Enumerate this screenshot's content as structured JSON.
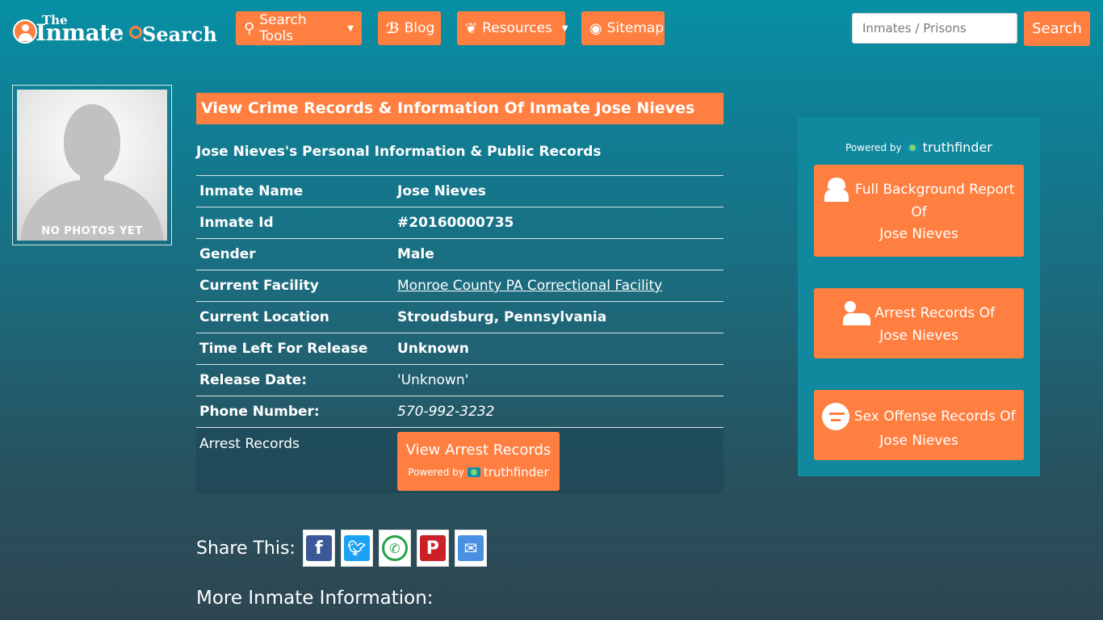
{
  "header": {
    "logo": {
      "the": "The",
      "inmate": "Inmate",
      "search": "Search"
    },
    "nav": [
      {
        "label": "Search Tools",
        "icon": "search-icon",
        "dropdown": true
      },
      {
        "label": "Blog",
        "icon": "blog-icon",
        "dropdown": false
      },
      {
        "label": "Resources",
        "icon": "leaf-icon",
        "dropdown": true
      },
      {
        "label": "Sitemap",
        "icon": "rss-icon",
        "dropdown": false
      }
    ],
    "search": {
      "placeholder": "Inmates / Prisons",
      "button": "Search"
    }
  },
  "photo": {
    "label": "NO PHOTOS YET"
  },
  "main": {
    "title": "View Crime Records & Information Of Inmate Jose Nieves",
    "subtitle": "Jose Nieves's Personal Information & Public Records",
    "rows": [
      {
        "key": "Inmate Name",
        "value": "Jose Nieves"
      },
      {
        "key": "Inmate Id",
        "value": "#20160000735"
      },
      {
        "key": "Gender",
        "value": "Male"
      },
      {
        "key": "Current Facility",
        "value": "Monroe County PA Correctional Facility"
      },
      {
        "key": "Current Location",
        "value": "Stroudsburg, Pennsylvania"
      },
      {
        "key": "Time Left For Release",
        "value": "Unknown"
      },
      {
        "key": "Release Date:",
        "value": "'Unknown'"
      },
      {
        "key": "Phone Number:",
        "value": "570-992-3232"
      }
    ],
    "arrest": {
      "key": "Arrest Records",
      "button": "View Arrest Records",
      "powered": "Powered by",
      "brand": "truthfinder"
    },
    "share": {
      "label": "Share This:",
      "networks": [
        "facebook",
        "twitter",
        "whatsapp",
        "pinterest",
        "email"
      ]
    },
    "more": "More Inmate Information:"
  },
  "sidebar": {
    "powered": "Powered by",
    "brand": "truthfinder",
    "boxes": [
      {
        "line1": "Full Background Report",
        "line2": "Of",
        "line3": "Jose Nieves",
        "icon": "spy-icon"
      },
      {
        "line1": "Arrest Records Of",
        "line2": "Jose Nieves",
        "icon": "user-lock-icon"
      },
      {
        "line1": "Sex Offense Records Of",
        "line2": "Jose Nieves",
        "icon": "angry-face-icon"
      }
    ]
  },
  "colors": {
    "accent": "#ff7f40",
    "sidebar": "#10889d",
    "background_top": "#0790a5",
    "background_bottom": "#2e4652"
  }
}
